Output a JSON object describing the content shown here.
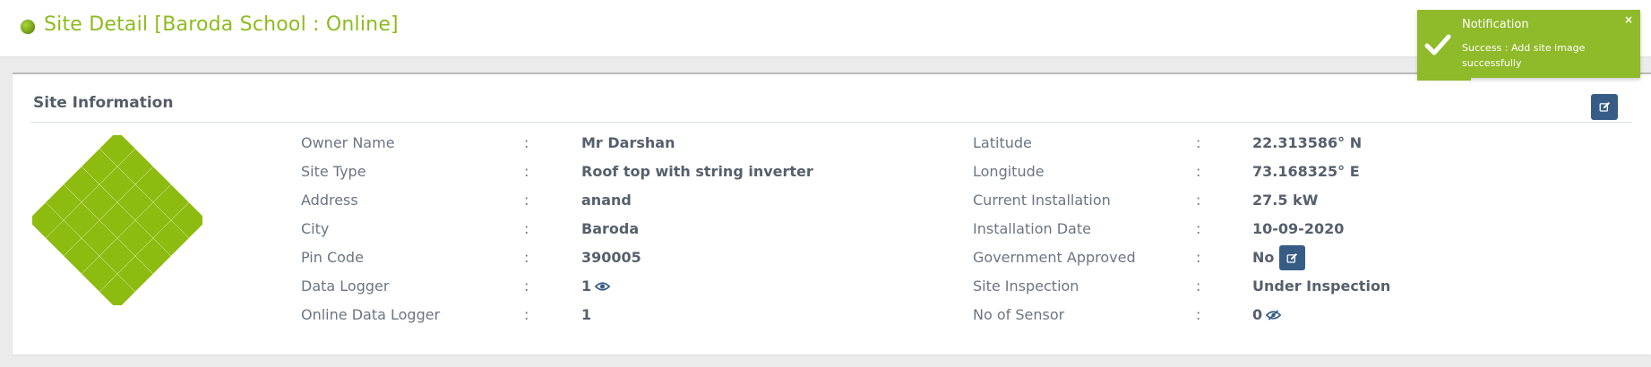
{
  "header": {
    "title": "Site Detail [Baroda School : Online]",
    "status": "online",
    "status_color": "#8dbb1e"
  },
  "card": {
    "title": "Site Information",
    "edit_icon": "edit-icon"
  },
  "left_fields": [
    {
      "label": "Owner Name",
      "colon": ":",
      "value": "Mr Darshan"
    },
    {
      "label": "Site Type",
      "colon": ":",
      "value": "Roof top with string inverter"
    },
    {
      "label": "Address",
      "colon": ":",
      "value": "anand"
    },
    {
      "label": "City",
      "colon": ":",
      "value": "Baroda"
    },
    {
      "label": "Pin Code",
      "colon": ":",
      "value": "390005"
    },
    {
      "label": "Data Logger",
      "colon": ":",
      "value": "1",
      "icon": "eye-icon"
    },
    {
      "label": "Online Data Logger",
      "colon": ":",
      "value": "1"
    }
  ],
  "right_fields": [
    {
      "label": "Latitude",
      "colon": ":",
      "value": "22.313586° N"
    },
    {
      "label": "Longitude",
      "colon": ":",
      "value": "73.168325° E"
    },
    {
      "label": "Current Installation",
      "colon": ":",
      "value": "27.5 kW"
    },
    {
      "label": "Installation Date",
      "colon": ":",
      "value": "10-09-2020"
    },
    {
      "label": "Government Approved",
      "colon": ":",
      "value": "No",
      "icon": "edit-icon"
    },
    {
      "label": "Site Inspection",
      "colon": ":",
      "value": "Under Inspection"
    },
    {
      "label": "No of Sensor",
      "colon": ":",
      "value": "0",
      "icon": "eye-slash-icon"
    }
  ],
  "notification": {
    "title": "Notification",
    "message": "Success : Add site image successfully",
    "close": "×",
    "icon": "check-icon",
    "color": "#8fba2a"
  },
  "colors": {
    "accent": "#8dbb1e",
    "button": "#375d86",
    "logo": "#8dbb0f"
  }
}
